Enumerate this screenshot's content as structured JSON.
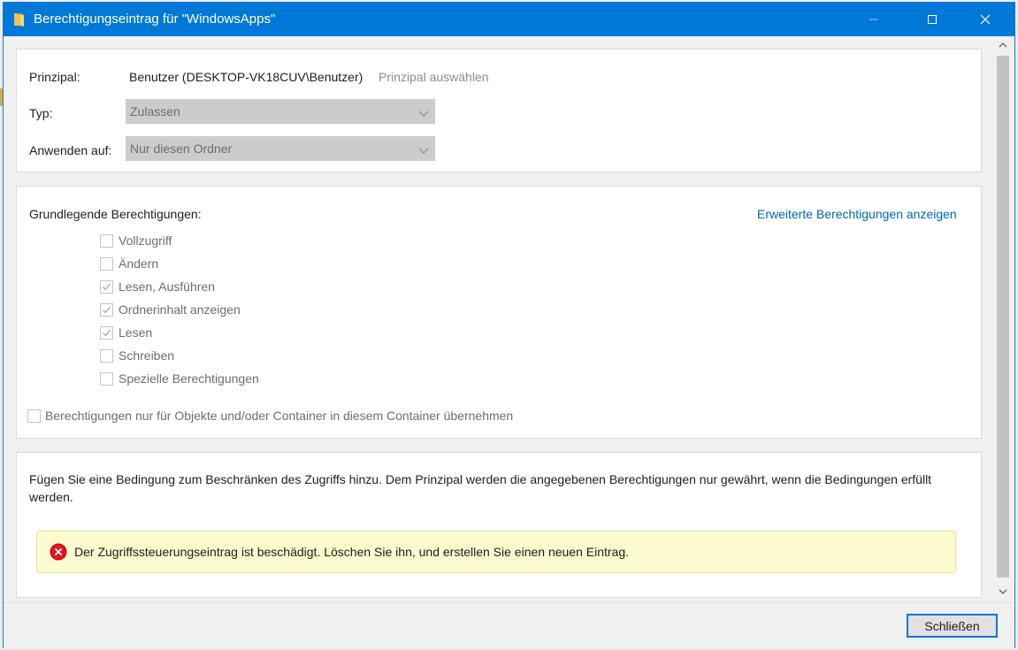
{
  "window": {
    "title": "Berechtigungseintrag für \"WindowsApps\"",
    "accent_color": "#0078d7"
  },
  "principal": {
    "label": "Prinzipal:",
    "value": "Benutzer (DESKTOP-VK18CUV\\Benutzer)",
    "select_link": "Prinzipal auswählen"
  },
  "type": {
    "label": "Typ:",
    "value": "Zulassen"
  },
  "apply_to": {
    "label": "Anwenden auf:",
    "value": "Nur diesen Ordner"
  },
  "permissions": {
    "heading": "Grundlegende Berechtigungen:",
    "advanced_link": "Erweiterte Berechtigungen anzeigen",
    "items": [
      {
        "label": "Vollzugriff",
        "checked": false
      },
      {
        "label": "Ändern",
        "checked": false
      },
      {
        "label": "Lesen, Ausführen",
        "checked": true
      },
      {
        "label": "Ordnerinhalt anzeigen",
        "checked": true
      },
      {
        "label": "Lesen",
        "checked": true
      },
      {
        "label": "Schreiben",
        "checked": false
      },
      {
        "label": "Spezielle Berechtigungen",
        "checked": false
      }
    ],
    "inherit_label": "Berechtigungen nur für Objekte und/oder Container in diesem Container übernehmen",
    "inherit_checked": false
  },
  "condition": {
    "text": "Fügen Sie eine Bedingung zum Beschränken des Zugriffs hinzu. Dem Prinzipal werden die angegebenen Berechtigungen nur gewährt, wenn die Bedingungen erfüllt werden.",
    "error": "Der Zugriffssteuerungseintrag ist beschädigt. Löschen Sie ihn, und erstellen Sie einen neuen Eintrag."
  },
  "footer": {
    "close_label": "Schließen"
  }
}
